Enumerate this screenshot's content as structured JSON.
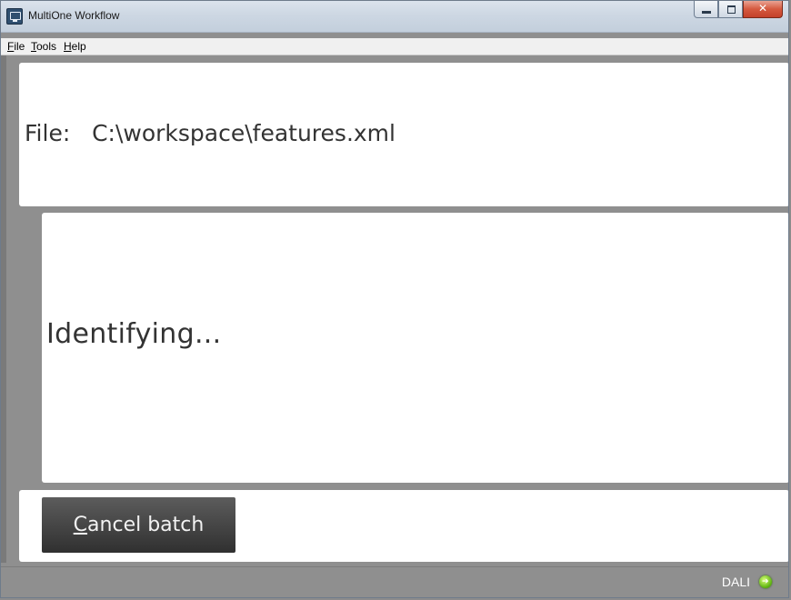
{
  "window": {
    "title": "MultiOne Workflow"
  },
  "menu": {
    "file": {
      "accel": "F",
      "rest": "ile"
    },
    "tools": {
      "accel": "T",
      "rest": "ools"
    },
    "help": {
      "accel": "H",
      "rest": "elp"
    }
  },
  "file_panel": {
    "label": "File:   C:\\workspace\\features.xml"
  },
  "progress": {
    "status": "Identifying..."
  },
  "actions": {
    "cancel_accel": "C",
    "cancel_rest": "ancel batch"
  },
  "statusbar": {
    "protocol": "DALI",
    "indicator_icon": "green-arrow-circle-icon",
    "indicator_color": "#59b00c"
  }
}
